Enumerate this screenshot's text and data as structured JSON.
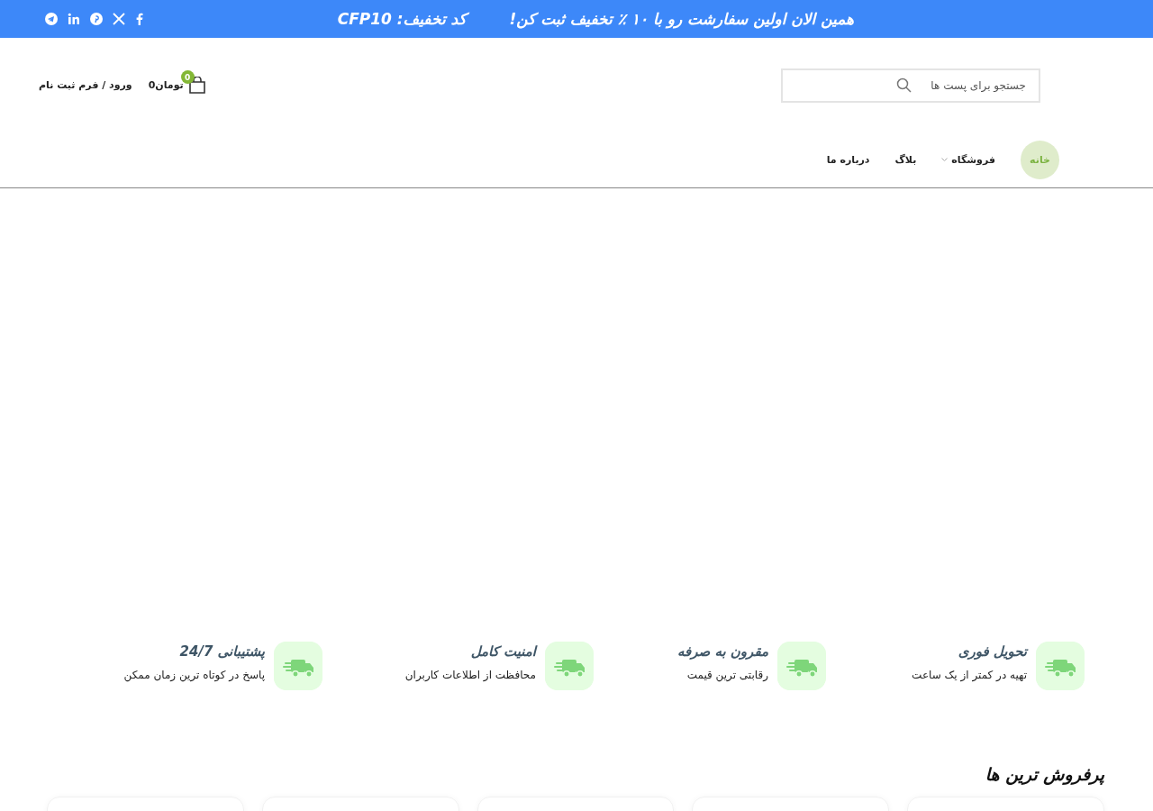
{
  "top_bar": {
    "promo": "همین الان اولین سفارشت رو با ۱۰ ٪ تخفیف ثبت کن!",
    "coupon": "کد تخفیف: CFP10",
    "social": [
      {
        "kind": "facebook"
      },
      {
        "kind": "x"
      },
      {
        "kind": "pinterest"
      },
      {
        "kind": "linkedin"
      },
      {
        "kind": "telegram"
      }
    ]
  },
  "header": {
    "search": {
      "placeholder": "جستجو برای پست ها"
    },
    "cart": {
      "count": "0",
      "total": "تومان0"
    },
    "login": "ورود / فرم ثبت نام"
  },
  "nav": [
    {
      "label": "خانه",
      "selected": true,
      "dropdown": false
    },
    {
      "label": "فروشگاه",
      "selected": false,
      "dropdown": true
    },
    {
      "label": "بلاگ",
      "selected": false,
      "dropdown": false
    },
    {
      "label": "درباره ما",
      "selected": false,
      "dropdown": false
    }
  ],
  "features": [
    {
      "title": "تحویل فوری",
      "text": "تهیه در کمتر از یک ساعت"
    },
    {
      "title": "مقرون به صرفه",
      "text": "رقابتی ترین قیمت"
    },
    {
      "title": "امنیت کامل",
      "text": "محافظت از اطلاعات کاربران"
    },
    {
      "title": "پشتیبانی 24/7",
      "text": "پاسخ در کوتاه ترین زمان ممکن"
    }
  ],
  "bestsellers": {
    "title": "پرفروش ترین ها"
  }
}
